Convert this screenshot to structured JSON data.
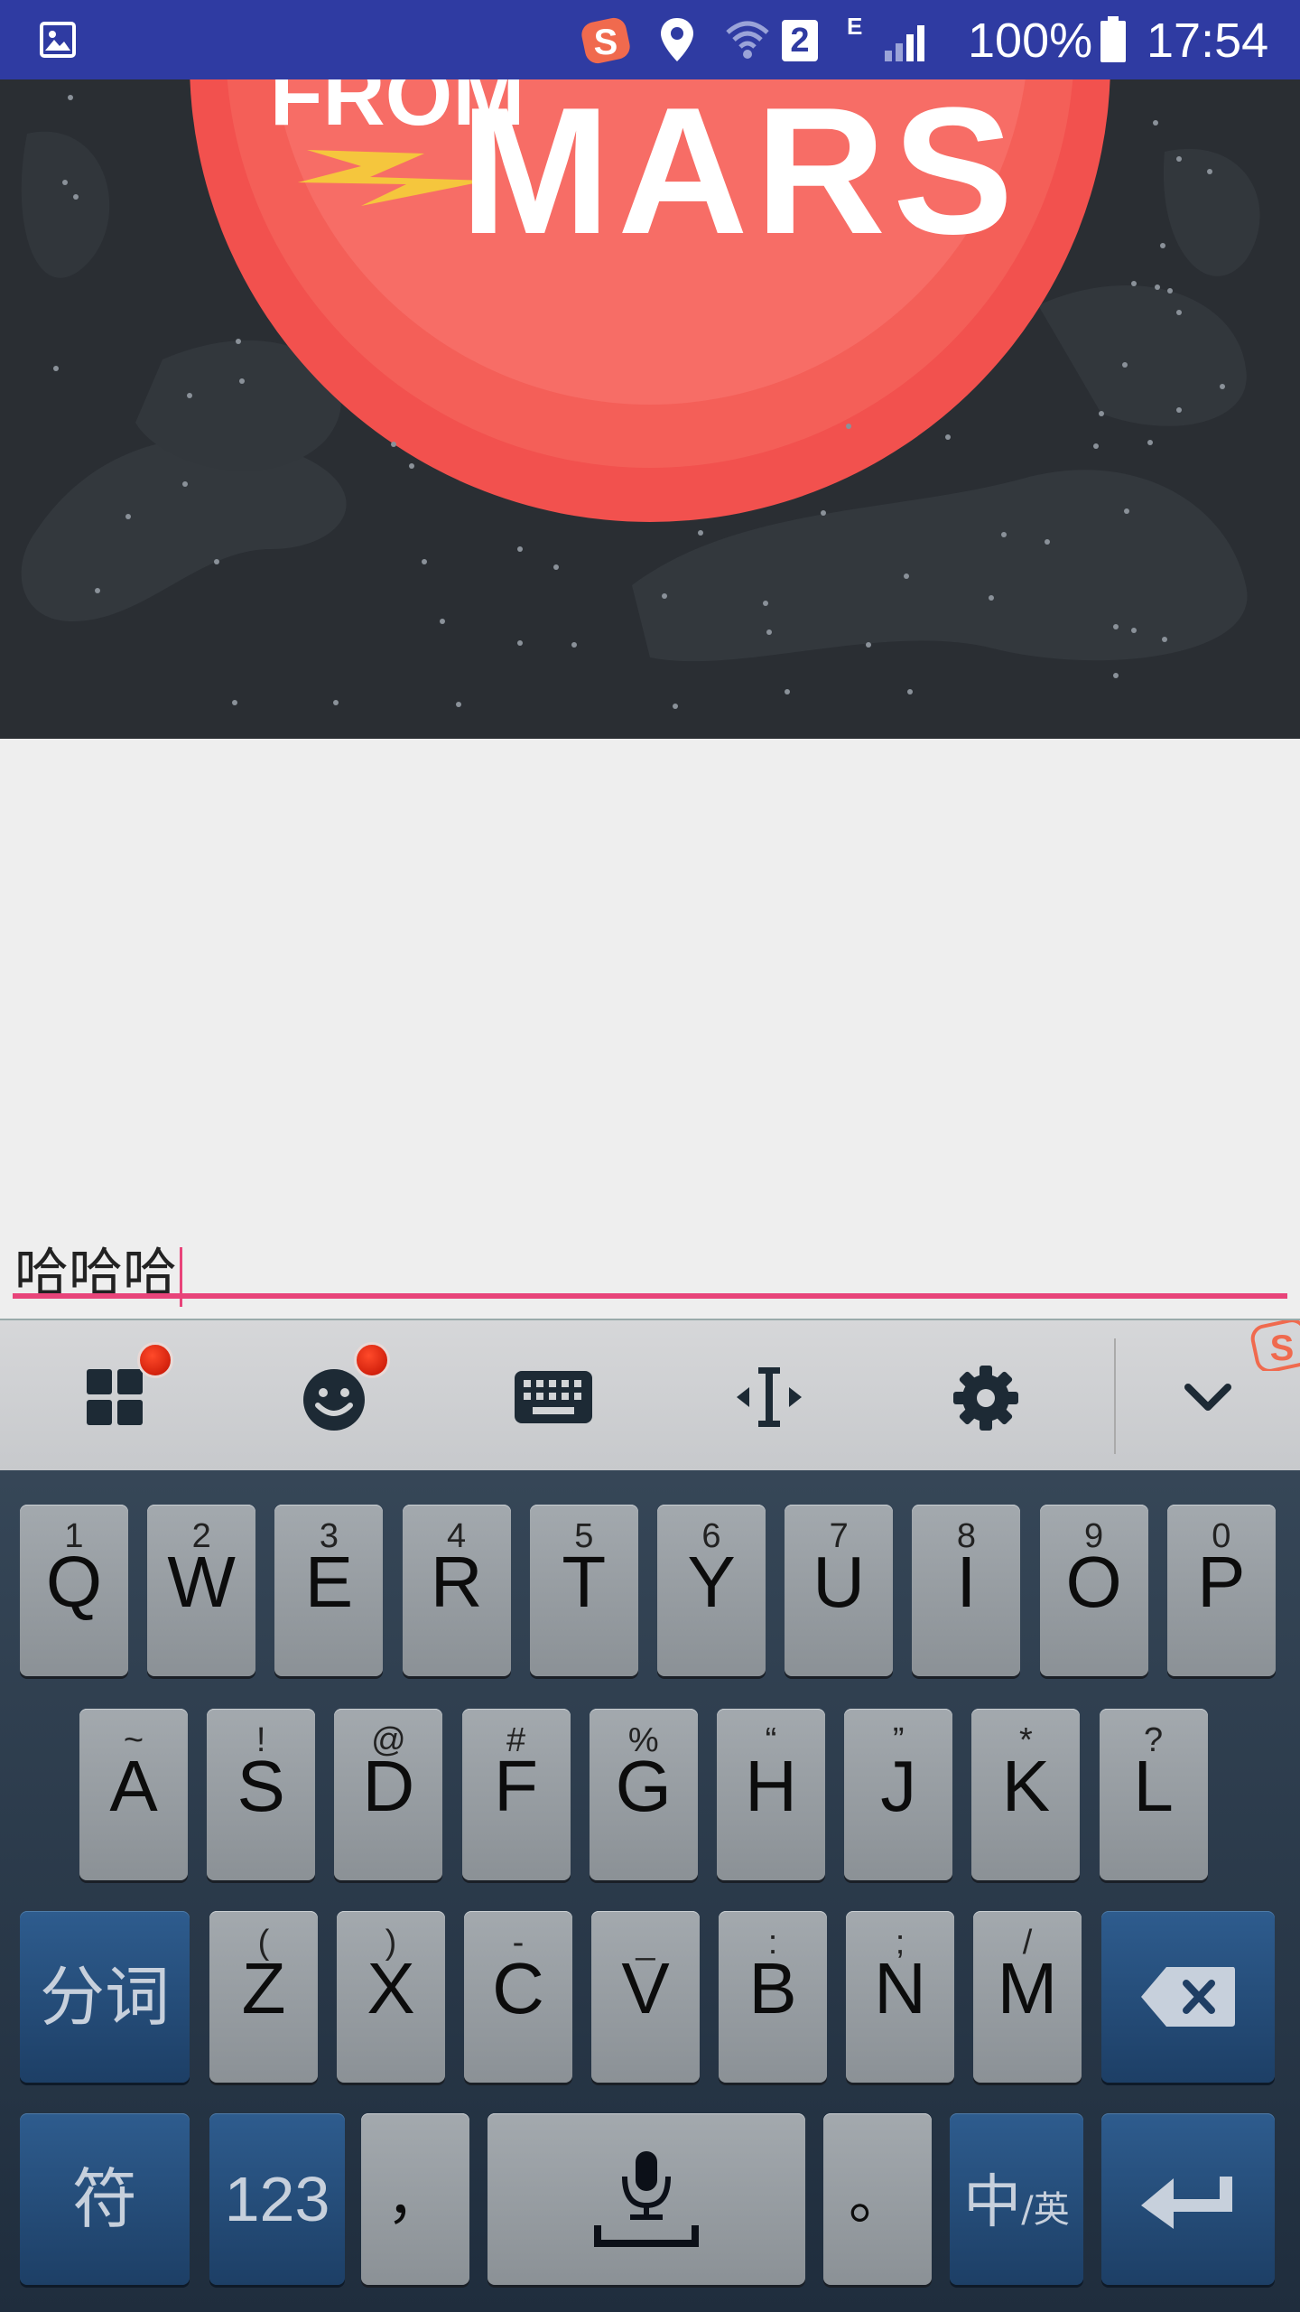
{
  "status_bar": {
    "network_type": "E",
    "sim_slot": "2",
    "battery": "100%",
    "time": "17:54",
    "icons": [
      "gallery-icon",
      "sogou-s-icon",
      "location-icon",
      "wifi-icon",
      "sim-icon",
      "signal-icon",
      "battery-icon"
    ]
  },
  "hero": {
    "title_small": "FROM",
    "title_large": "MARS",
    "colors": {
      "sky": "#2a2e33",
      "planet": "#f2514e",
      "planet_light": "#f76d66"
    }
  },
  "input": {
    "value": "哈哈哈",
    "accent_color": "#e8447a"
  },
  "keyboard": {
    "toolbar": [
      "apps-grid-icon",
      "emoji-icon",
      "keyboard-icon",
      "cursor-move-icon",
      "settings-gear-icon",
      "collapse-chevron-icon"
    ],
    "row1": [
      {
        "main": "Q",
        "sub": "1"
      },
      {
        "main": "W",
        "sub": "2"
      },
      {
        "main": "E",
        "sub": "3"
      },
      {
        "main": "R",
        "sub": "4"
      },
      {
        "main": "T",
        "sub": "5"
      },
      {
        "main": "Y",
        "sub": "6"
      },
      {
        "main": "U",
        "sub": "7"
      },
      {
        "main": "I",
        "sub": "8"
      },
      {
        "main": "O",
        "sub": "9"
      },
      {
        "main": "P",
        "sub": "0"
      }
    ],
    "row2": [
      {
        "main": "A",
        "sub": "~"
      },
      {
        "main": "S",
        "sub": "!"
      },
      {
        "main": "D",
        "sub": "@"
      },
      {
        "main": "F",
        "sub": "#"
      },
      {
        "main": "G",
        "sub": "%"
      },
      {
        "main": "H",
        "sub": "“"
      },
      {
        "main": "J",
        "sub": "”"
      },
      {
        "main": "K",
        "sub": "*"
      },
      {
        "main": "L",
        "sub": "?"
      }
    ],
    "row3": [
      {
        "main": "Z",
        "sub": "("
      },
      {
        "main": "X",
        "sub": ")"
      },
      {
        "main": "C",
        "sub": "-"
      },
      {
        "main": "V",
        "sub": "_"
      },
      {
        "main": "B",
        "sub": ":"
      },
      {
        "main": "N",
        "sub": ";"
      },
      {
        "main": "M",
        "sub": "/"
      }
    ],
    "segment_label": "分词",
    "symbols_label": "符",
    "numbers_label": "123",
    "comma_label": "，",
    "period_label": "。",
    "lang_main_label": "中",
    "lang_alt_label": "/英"
  }
}
